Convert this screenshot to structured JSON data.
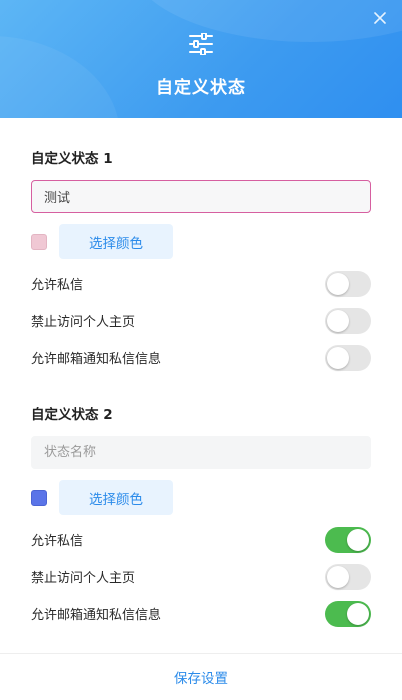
{
  "dialog": {
    "title": "自定义状态",
    "header_icon": "sliders-icon",
    "close_icon": "close-icon"
  },
  "colors": {
    "header_gradient": [
      "#5db6f5",
      "#2f8ff0"
    ],
    "accent": "#2b8bea",
    "toggle_on": "#4cbb4f",
    "toggle_off": "#e5e5e5"
  },
  "statuses": [
    {
      "title": "自定义状态 1",
      "name_value": "测试",
      "name_placeholder": "状态名称",
      "color": "#f0c8d4",
      "color_button_label": "选择颜色",
      "options": [
        {
          "label": "允许私信",
          "on": false
        },
        {
          "label": "禁止访问个人主页",
          "on": false
        },
        {
          "label": "允许邮箱通知私信信息",
          "on": false
        }
      ]
    },
    {
      "title": "自定义状态 2",
      "name_value": "",
      "name_placeholder": "状态名称",
      "color": "#5a74e8",
      "color_button_label": "选择颜色",
      "options": [
        {
          "label": "允许私信",
          "on": true
        },
        {
          "label": "禁止访问个人主页",
          "on": false
        },
        {
          "label": "允许邮箱通知私信信息",
          "on": true
        }
      ]
    }
  ],
  "footer": {
    "save_label": "保存设置"
  }
}
